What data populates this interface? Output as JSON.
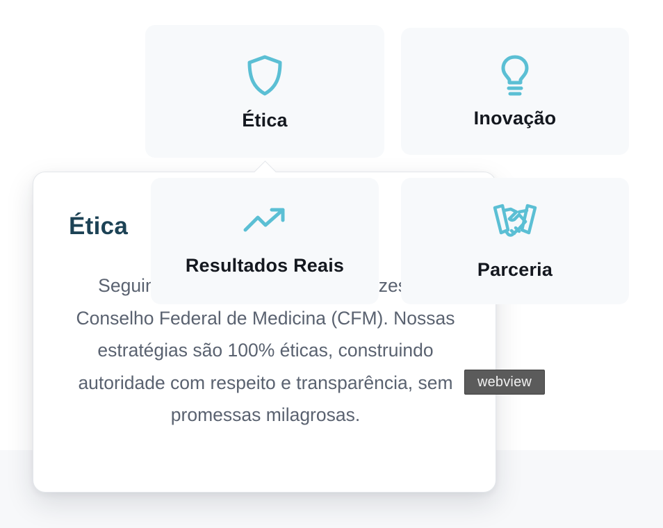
{
  "cards": {
    "etica": {
      "label": "Ética",
      "icon": "shield-icon"
    },
    "inovacao": {
      "label": "Inovação",
      "icon": "lightbulb-icon"
    },
    "resultados": {
      "label": "Resultados Reais",
      "icon": "trending-up-icon"
    },
    "parceria": {
      "label": "Parceria",
      "icon": "handshake-icon"
    }
  },
  "tooltip": {
    "title": "Ética",
    "body": "Seguimos rigorosamente as diretrizes do Conselho Federal de Medicina (CFM). Nossas estratégias são 100% éticas, construindo autoridade com respeito e transparência, sem promessas milagrosas."
  },
  "badge": {
    "label": "webview"
  },
  "colors": {
    "accent": "#5bbfd4",
    "title": "#1c4255",
    "body_text": "#5a6270",
    "card_bg": "#f7f9fb",
    "badge_bg": "#5b5b5b"
  }
}
